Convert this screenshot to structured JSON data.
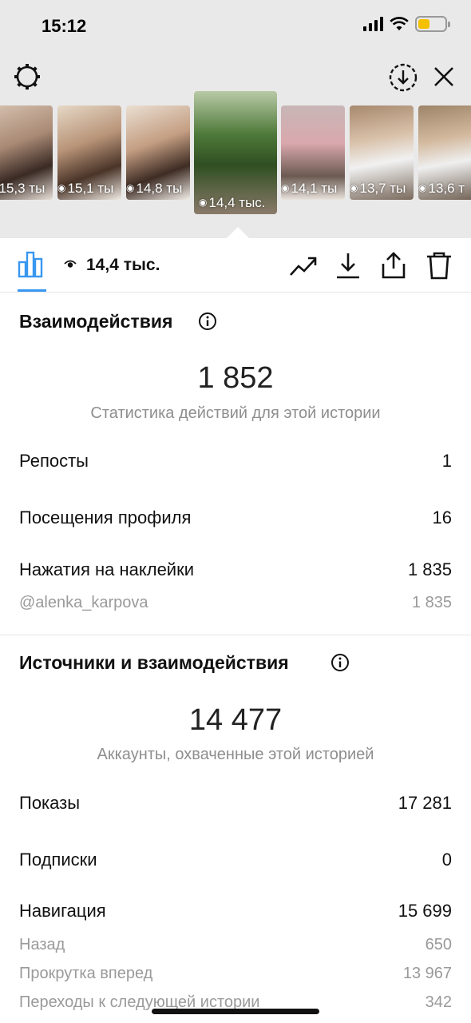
{
  "status_bar": {
    "time": "15:12"
  },
  "thumbnails": [
    {
      "views": "15,3 ты",
      "selected": false
    },
    {
      "views": "15,1 ты",
      "selected": false
    },
    {
      "views": "14,8 ты",
      "selected": false
    },
    {
      "views": "14,4 тыс.",
      "selected": true
    },
    {
      "views": "14,1 ты",
      "selected": false
    },
    {
      "views": "13,7 ты",
      "selected": false
    },
    {
      "views": "13,6 т",
      "selected": false
    }
  ],
  "stats_bar": {
    "views": "14,4 тыс."
  },
  "interactions": {
    "title": "Взаимодействия",
    "total": "1 852",
    "subtitle": "Статистика действий для этой истории",
    "rows": [
      {
        "label": "Репосты",
        "value": "1"
      },
      {
        "label": "Посещения профиля",
        "value": "16"
      },
      {
        "label": "Нажатия на наклейки",
        "value": "1 835"
      },
      {
        "label": "@alenka_karpova",
        "value": "1 835"
      }
    ]
  },
  "discovery": {
    "title": "Источники и взаимодействия",
    "total": "14 477",
    "subtitle": "Аккаунты, охваченные этой историей",
    "rows": [
      {
        "label": "Показы",
        "value": "17 281"
      },
      {
        "label": "Подписки",
        "value": "0"
      },
      {
        "label": "Навигация",
        "value": "15 699"
      },
      {
        "label": "Назад",
        "value": "650"
      },
      {
        "label": "Прокрутка вперед",
        "value": "13 967"
      },
      {
        "label": "Переходы к следующей истории",
        "value": "342"
      }
    ]
  },
  "colors": {
    "accent": "#3897f0",
    "muted": "#8e8e8e",
    "battery": "#f4c000"
  }
}
